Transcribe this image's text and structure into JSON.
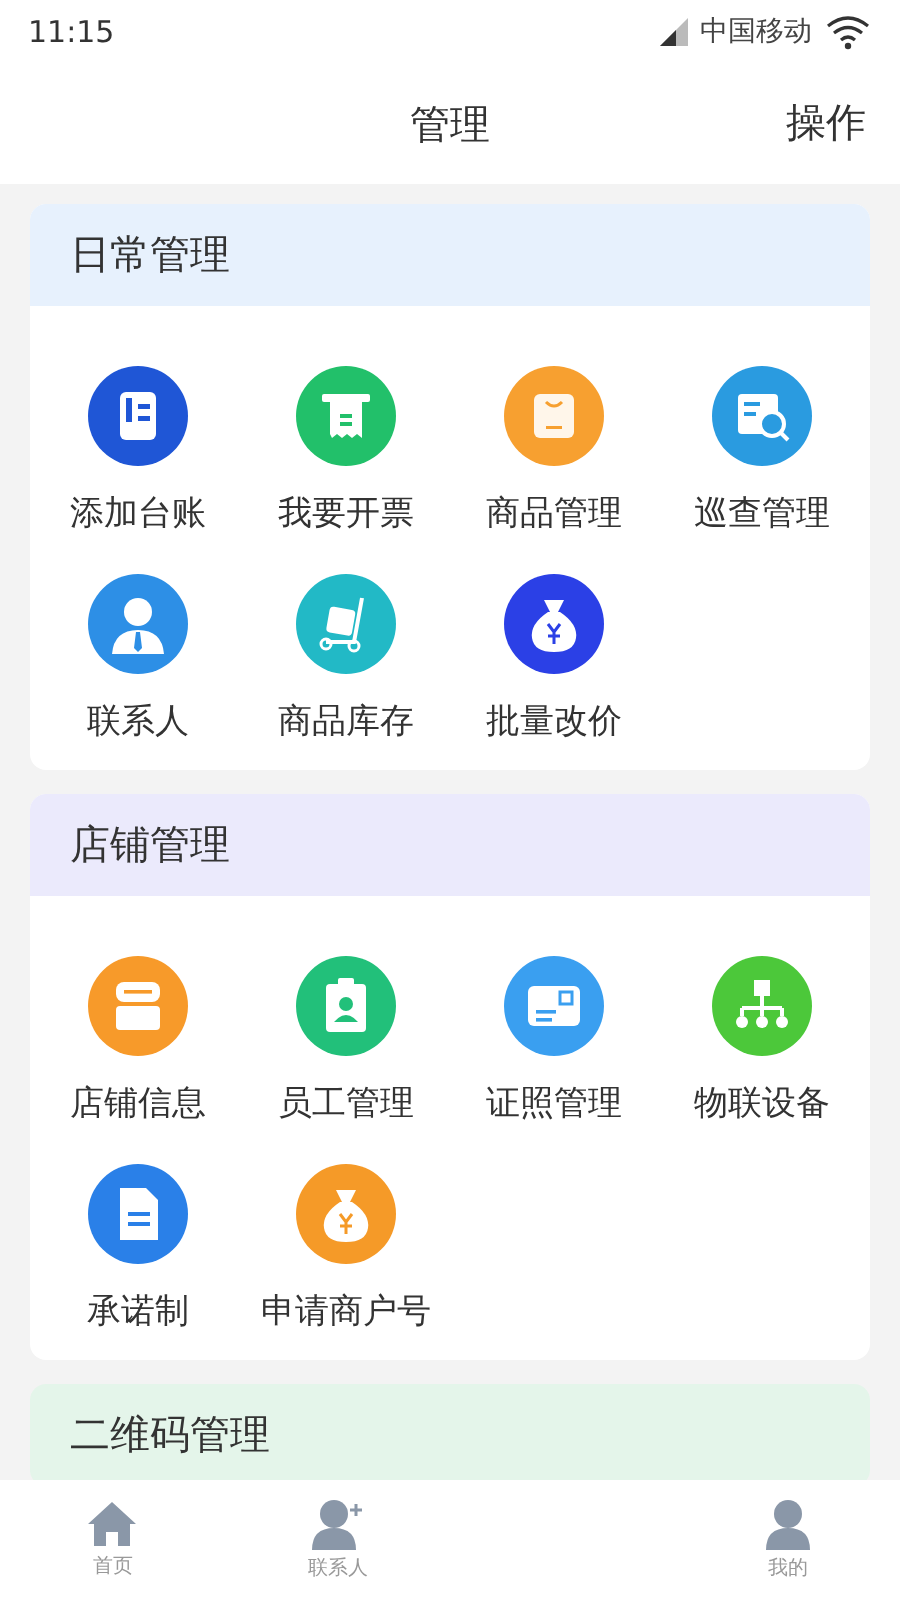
{
  "status_bar": {
    "time": "11:15",
    "carrier": "中国移动"
  },
  "header": {
    "title": "管理",
    "action": "操作"
  },
  "sections": [
    {
      "title": "日常管理",
      "color": "#e7f1fd",
      "items": [
        {
          "label": "添加台账",
          "color": "#1f56d6"
        },
        {
          "label": "我要开票",
          "color": "#22c06a"
        },
        {
          "label": "商品管理",
          "color": "#f7a030"
        },
        {
          "label": "巡查管理",
          "color": "#2a9be0"
        },
        {
          "label": "联系人",
          "color": "#2d8fe6"
        },
        {
          "label": "商品库存",
          "color": "#22b9c6"
        },
        {
          "label": "批量改价",
          "color": "#2b40e6"
        }
      ]
    },
    {
      "title": "店铺管理",
      "color": "#ebeafc",
      "items": [
        {
          "label": "店铺信息",
          "color": "#f79a2a"
        },
        {
          "label": "员工管理",
          "color": "#22c07a"
        },
        {
          "label": "证照管理",
          "color": "#3a9ff0"
        },
        {
          "label": "物联设备",
          "color": "#4cc83a"
        },
        {
          "label": "承诺制",
          "color": "#2a80e8"
        },
        {
          "label": "申请商户号",
          "color": "#f59a28"
        }
      ]
    },
    {
      "title": "二维码管理",
      "color": "#e4f5ea"
    }
  ],
  "tab_bar": [
    {
      "label": "首页"
    },
    {
      "label": "联系人"
    },
    {
      "label": "我的"
    }
  ]
}
